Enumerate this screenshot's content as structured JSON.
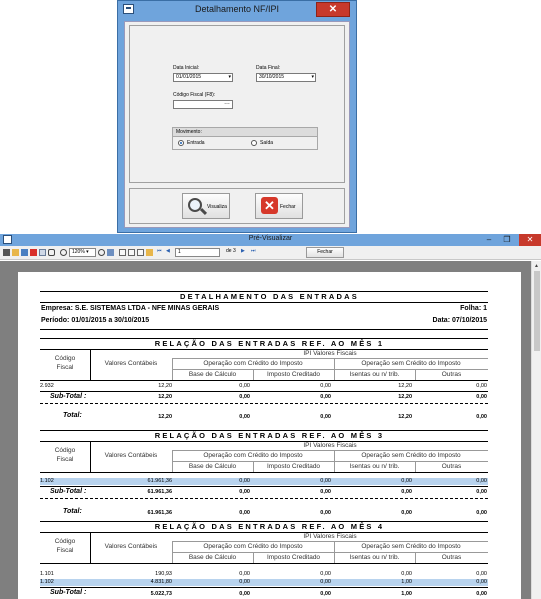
{
  "dialog": {
    "title": "Detalhamento NF/IPI",
    "close_glyph": "✕",
    "data_inicial_label": "Data Inicial:",
    "data_inicial_value": "01/01/2015",
    "data_final_label": "Data Final:",
    "data_final_value": "30/10/2015",
    "codigo_fiscal_label": "Código Fiscal (F8):",
    "codigo_fiscal_value": "",
    "movimento_label": "Movimento:",
    "entrada_label": "Entrada",
    "saida_label": "Saída",
    "selected_movimento": "Entrada",
    "visualiza_label": "Visualiza",
    "fechar_label": "Fechar"
  },
  "preview": {
    "title": "Pré-Visualizar",
    "zoom": "120%",
    "page_current": "1",
    "page_total_label": "de 3",
    "close_label": "Fechar"
  },
  "report": {
    "title": "DETALHAMENTO DAS ENTRADAS",
    "empresa": "Empresa: S.E. SISTEMAS LTDA - NFE MINAS GERAIS",
    "folha": "Folha: 1",
    "periodo": "Período: 01/01/2015 a 30/10/2015",
    "data": "Data: 07/10/2015",
    "headers": {
      "codigo": "Código",
      "fiscal": "Fiscal",
      "valores": "Valores Contábeis",
      "ipi": "IPI Valores Fiscais",
      "com_credito": "Operação com Crédito do Imposto",
      "sem_credito": "Operação sem Crédito do Imposto",
      "base": "Base de Cálculo",
      "creditado": "Imposto Creditado",
      "isentas": "Isentas ou n/ trib.",
      "outras": "Outras"
    },
    "subtotal_label": "Sub-Total :",
    "total_label": "Total:",
    "sections": [
      {
        "title": "RELAÇÃO DAS ENTRADAS REF. AO MÊS 1",
        "rows": [
          {
            "cfop": "2.932",
            "valores": "12,20",
            "base": "0,00",
            "creditado": "0,00",
            "isentas": "12,20",
            "outras": "0,00"
          }
        ],
        "subtotal": {
          "valores": "12,20",
          "base": "0,00",
          "creditado": "0,00",
          "isentas": "12,20",
          "outras": "0,00"
        },
        "total": {
          "valores": "12,20",
          "base": "0,00",
          "creditado": "0,00",
          "isentas": "12,20",
          "outras": "0,00"
        }
      },
      {
        "title": "RELAÇÃO DAS ENTRADAS REF. AO MÊS 3",
        "rows": [
          {
            "cfop": "1.102",
            "valores": "61.961,36",
            "base": "0,00",
            "creditado": "0,00",
            "isentas": "0,00",
            "outras": "0,00"
          }
        ],
        "subtotal": {
          "valores": "61.961,36",
          "base": "0,00",
          "creditado": "0,00",
          "isentas": "0,00",
          "outras": "0,00"
        },
        "total": {
          "valores": "61.961,36",
          "base": "0,00",
          "creditado": "0,00",
          "isentas": "0,00",
          "outras": "0,00"
        }
      },
      {
        "title": "RELAÇÃO DAS ENTRADAS REF. AO MÊS 4",
        "rows": [
          {
            "cfop": "1.101",
            "valores": "190,93",
            "base": "0,00",
            "creditado": "0,00",
            "isentas": "0,00",
            "outras": "0,00"
          },
          {
            "cfop": "1.102",
            "valores": "4.831,80",
            "base": "0,00",
            "creditado": "0,00",
            "isentas": "1,00",
            "outras": "0,00"
          }
        ],
        "subtotal": {
          "valores": "5.022,73",
          "base": "0,00",
          "creditado": "0,00",
          "isentas": "1,00",
          "outras": "0,00"
        }
      }
    ]
  }
}
